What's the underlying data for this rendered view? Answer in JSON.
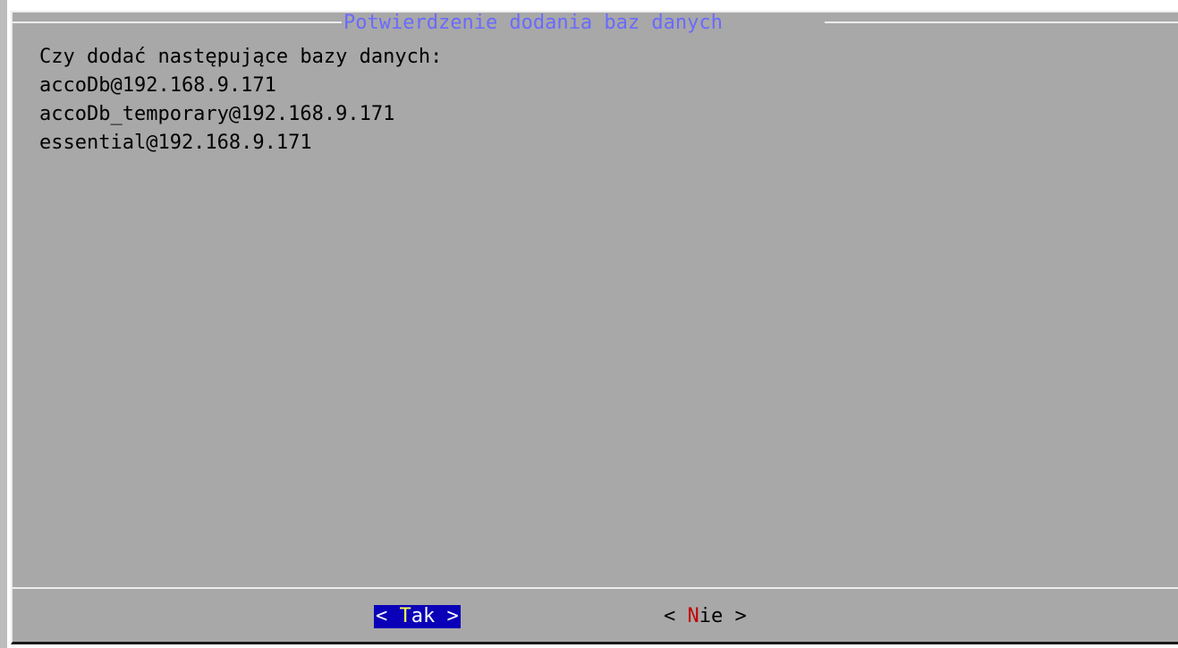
{
  "dialog": {
    "title": "Potwierdzenie dodania baz danych",
    "message": "Czy dodać następujące bazy danych:",
    "databases": [
      "accoDb@192.168.9.171",
      "accoDb_temporary@192.168.9.171",
      "essential@192.168.9.171"
    ]
  },
  "buttons": {
    "yes": {
      "left_bracket": "< ",
      "hotkey": "T",
      "rest": "ak",
      "right_bracket": " >",
      "focused": true
    },
    "no": {
      "left_bracket": "< ",
      "hotkey": "N",
      "rest": "ie",
      "right_bracket": " >",
      "focused": false
    }
  },
  "colors": {
    "dialog_background": "#a8a8a8",
    "title": "#6a6aff",
    "focused_button_background": "#0a00b8",
    "focused_hotkey": "#ffff55",
    "unfocused_hotkey": "#c40000"
  }
}
